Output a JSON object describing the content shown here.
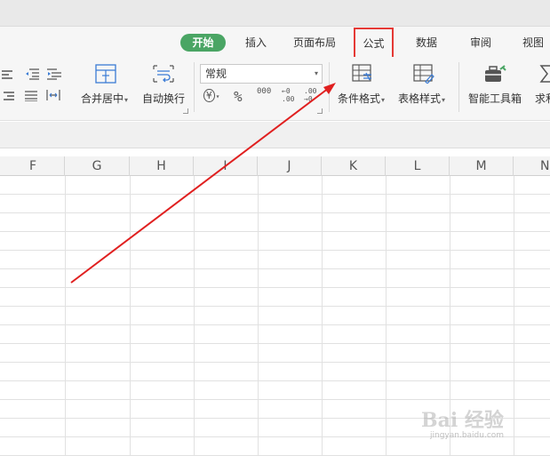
{
  "tabs": {
    "home": "开始",
    "insert": "插入",
    "page_layout": "页面布局",
    "formulas": "公式",
    "data": "数据",
    "review": "审阅",
    "view": "视图"
  },
  "ribbon": {
    "merge_center": "合并居中",
    "wrap_text": "自动换行",
    "number_format": "常规",
    "conditional_format": "条件格式",
    "table_style": "表格样式",
    "smart_toolbox": "智能工具箱",
    "sum_partial": "求和",
    "currency_symbol": "¥",
    "percent_symbol": "%",
    "thousands_symbol": "000",
    "inc_decimal": "←0\n.00",
    "dec_decimal": ".00\n→0"
  },
  "columns": [
    "F",
    "G",
    "H",
    "I",
    "J",
    "K",
    "L",
    "M",
    "N"
  ],
  "watermark": {
    "main": "Bai 经验",
    "sub": "jingyan.baidu.com"
  },
  "colors": {
    "active_tab": "#4aa564",
    "highlight_box": "#e53935",
    "arrow": "#e02020"
  }
}
